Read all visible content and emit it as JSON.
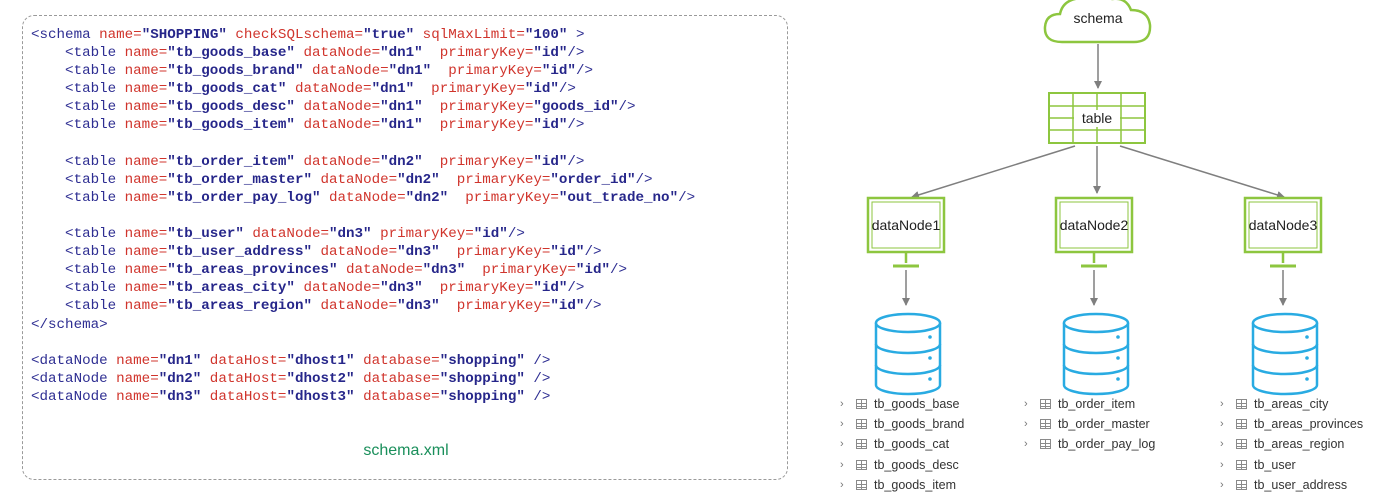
{
  "code": {
    "lines": [
      [
        [
          "tag",
          "<schema "
        ],
        [
          "attr",
          "name="
        ],
        [
          "val",
          "\"SHOPPING\""
        ],
        [
          "attr",
          " checkSQLschema="
        ],
        [
          "val",
          "\"true\""
        ],
        [
          "attr",
          " sqlMaxLimit="
        ],
        [
          "val",
          "\"100\""
        ],
        [
          "tag",
          " >"
        ]
      ],
      [
        [
          "tag",
          "    <table "
        ],
        [
          "attr",
          "name="
        ],
        [
          "val",
          "\"tb_goods_base\""
        ],
        [
          "attr",
          " dataNode="
        ],
        [
          "val",
          "\"dn1\""
        ],
        [
          "attr",
          "  primaryKey="
        ],
        [
          "val",
          "\"id\""
        ],
        [
          "tag",
          "/>"
        ]
      ],
      [
        [
          "tag",
          "    <table "
        ],
        [
          "attr",
          "name="
        ],
        [
          "val",
          "\"tb_goods_brand\""
        ],
        [
          "attr",
          " dataNode="
        ],
        [
          "val",
          "\"dn1\""
        ],
        [
          "attr",
          "  primaryKey="
        ],
        [
          "val",
          "\"id\""
        ],
        [
          "tag",
          "/>"
        ]
      ],
      [
        [
          "tag",
          "    <table "
        ],
        [
          "attr",
          "name="
        ],
        [
          "val",
          "\"tb_goods_cat\""
        ],
        [
          "attr",
          " dataNode="
        ],
        [
          "val",
          "\"dn1\""
        ],
        [
          "attr",
          "  primaryKey="
        ],
        [
          "val",
          "\"id\""
        ],
        [
          "tag",
          "/>"
        ]
      ],
      [
        [
          "tag",
          "    <table "
        ],
        [
          "attr",
          "name="
        ],
        [
          "val",
          "\"tb_goods_desc\""
        ],
        [
          "attr",
          " dataNode="
        ],
        [
          "val",
          "\"dn1\""
        ],
        [
          "attr",
          "  primaryKey="
        ],
        [
          "val",
          "\"goods_id\""
        ],
        [
          "tag",
          "/>"
        ]
      ],
      [
        [
          "tag",
          "    <table "
        ],
        [
          "attr",
          "name="
        ],
        [
          "val",
          "\"tb_goods_item\""
        ],
        [
          "attr",
          " dataNode="
        ],
        [
          "val",
          "\"dn1\""
        ],
        [
          "attr",
          "  primaryKey="
        ],
        [
          "val",
          "\"id\""
        ],
        [
          "tag",
          "/>"
        ]
      ],
      [],
      [
        [
          "tag",
          "    <table "
        ],
        [
          "attr",
          "name="
        ],
        [
          "val",
          "\"tb_order_item\""
        ],
        [
          "attr",
          " dataNode="
        ],
        [
          "val",
          "\"dn2\""
        ],
        [
          "attr",
          "  primaryKey="
        ],
        [
          "val",
          "\"id\""
        ],
        [
          "tag",
          "/>"
        ]
      ],
      [
        [
          "tag",
          "    <table "
        ],
        [
          "attr",
          "name="
        ],
        [
          "val",
          "\"tb_order_master\""
        ],
        [
          "attr",
          " dataNode="
        ],
        [
          "val",
          "\"dn2\""
        ],
        [
          "attr",
          "  primaryKey="
        ],
        [
          "val",
          "\"order_id\""
        ],
        [
          "tag",
          "/>"
        ]
      ],
      [
        [
          "tag",
          "    <table "
        ],
        [
          "attr",
          "name="
        ],
        [
          "val",
          "\"tb_order_pay_log\""
        ],
        [
          "attr",
          " dataNode="
        ],
        [
          "val",
          "\"dn2\""
        ],
        [
          "attr",
          "  primaryKey="
        ],
        [
          "val",
          "\"out_trade_no\""
        ],
        [
          "tag",
          "/>"
        ]
      ],
      [],
      [
        [
          "tag",
          "    <table "
        ],
        [
          "attr",
          "name="
        ],
        [
          "val",
          "\"tb_user\""
        ],
        [
          "attr",
          " dataNode="
        ],
        [
          "val",
          "\"dn3\""
        ],
        [
          "attr",
          " primaryKey="
        ],
        [
          "val",
          "\"id\""
        ],
        [
          "tag",
          "/>"
        ]
      ],
      [
        [
          "tag",
          "    <table "
        ],
        [
          "attr",
          "name="
        ],
        [
          "val",
          "\"tb_user_address\""
        ],
        [
          "attr",
          " dataNode="
        ],
        [
          "val",
          "\"dn3\""
        ],
        [
          "attr",
          "  primaryKey="
        ],
        [
          "val",
          "\"id\""
        ],
        [
          "tag",
          "/>"
        ]
      ],
      [
        [
          "tag",
          "    <table "
        ],
        [
          "attr",
          "name="
        ],
        [
          "val",
          "\"tb_areas_provinces\""
        ],
        [
          "attr",
          " dataNode="
        ],
        [
          "val",
          "\"dn3\""
        ],
        [
          "attr",
          "  primaryKey="
        ],
        [
          "val",
          "\"id\""
        ],
        [
          "tag",
          "/>"
        ]
      ],
      [
        [
          "tag",
          "    <table "
        ],
        [
          "attr",
          "name="
        ],
        [
          "val",
          "\"tb_areas_city\""
        ],
        [
          "attr",
          " dataNode="
        ],
        [
          "val",
          "\"dn3\""
        ],
        [
          "attr",
          "  primaryKey="
        ],
        [
          "val",
          "\"id\""
        ],
        [
          "tag",
          "/>"
        ]
      ],
      [
        [
          "tag",
          "    <table "
        ],
        [
          "attr",
          "name="
        ],
        [
          "val",
          "\"tb_areas_region\""
        ],
        [
          "attr",
          " dataNode="
        ],
        [
          "val",
          "\"dn3\""
        ],
        [
          "attr",
          "  primaryKey="
        ],
        [
          "val",
          "\"id\""
        ],
        [
          "tag",
          "/>"
        ]
      ],
      [
        [
          "tag",
          "</schema>"
        ]
      ],
      [],
      [
        [
          "tag",
          "<dataNode "
        ],
        [
          "attr",
          "name="
        ],
        [
          "val",
          "\"dn1\""
        ],
        [
          "attr",
          " dataHost="
        ],
        [
          "val",
          "\"dhost1\""
        ],
        [
          "attr",
          " database="
        ],
        [
          "val",
          "\"shopping\""
        ],
        [
          "tag",
          " />"
        ]
      ],
      [
        [
          "tag",
          "<dataNode "
        ],
        [
          "attr",
          "name="
        ],
        [
          "val",
          "\"dn2\""
        ],
        [
          "attr",
          " dataHost="
        ],
        [
          "val",
          "\"dhost2\""
        ],
        [
          "attr",
          " database="
        ],
        [
          "val",
          "\"shopping\""
        ],
        [
          "tag",
          " />"
        ]
      ],
      [
        [
          "tag",
          "<dataNode "
        ],
        [
          "attr",
          "name="
        ],
        [
          "val",
          "\"dn3\""
        ],
        [
          "attr",
          " dataHost="
        ],
        [
          "val",
          "\"dhost3\""
        ],
        [
          "attr",
          " database="
        ],
        [
          "val",
          "\"shopping\""
        ],
        [
          "tag",
          " />"
        ]
      ]
    ],
    "file_label": "schema.xml"
  },
  "diagram": {
    "schema_label": "schema",
    "table_label": "table",
    "nodes": [
      {
        "label": "dataNode1",
        "tables": [
          "tb_goods_base",
          "tb_goods_brand",
          "tb_goods_cat",
          "tb_goods_desc",
          "tb_goods_item"
        ]
      },
      {
        "label": "dataNode2",
        "tables": [
          "tb_order_item",
          "tb_order_master",
          "tb_order_pay_log"
        ]
      },
      {
        "label": "dataNode3",
        "tables": [
          "tb_areas_city",
          "tb_areas_provinces",
          "tb_areas_region",
          "tb_user",
          "tb_user_address"
        ]
      }
    ],
    "colors": {
      "node_outline": "#8dc63f",
      "database_outline": "#29abe2",
      "arrow": "#7f7f7f"
    },
    "icons": {
      "schema": "cloud-icon",
      "table": "table-grid-icon",
      "data_node": "monitor-icon",
      "storage": "database-cylinder-icon",
      "expand": "chevron-right-icon",
      "table_entry": "table-icon"
    }
  }
}
